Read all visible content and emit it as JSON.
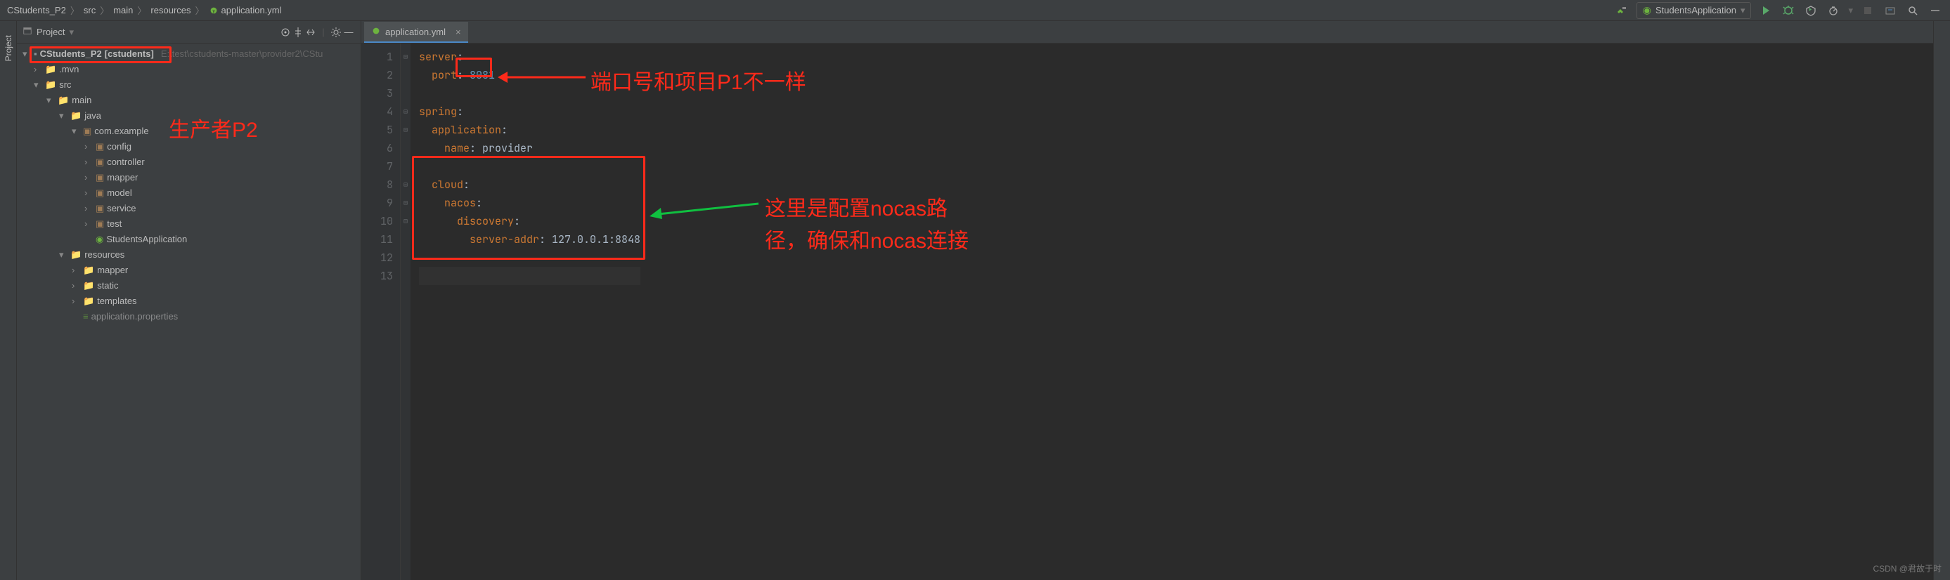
{
  "breadcrumb": {
    "items": [
      "CStudents_P2",
      "src",
      "main",
      "resources",
      "application.yml"
    ]
  },
  "run_config": {
    "name": "StudentsApplication"
  },
  "project_panel": {
    "title": "Project",
    "side_tab": "Project",
    "root": {
      "name": "CStudents_P2",
      "module": "[cstudents]",
      "path": "E:\\test\\cstudents-master\\provider2\\CStu"
    },
    "nodes": {
      "mvn": ".mvn",
      "src": "src",
      "main": "main",
      "java": "java",
      "pkg": "com.example",
      "config": "config",
      "controller": "controller",
      "mapper": "mapper",
      "model": "model",
      "service": "service",
      "test": "test",
      "students_app": "StudentsApplication",
      "resources": "resources",
      "mapper2": "mapper",
      "static": "static",
      "templates": "templates",
      "app_props": "application.properties"
    }
  },
  "editor": {
    "tab": {
      "file": "application.yml"
    },
    "lines": {
      "1": {
        "k1": "server",
        "c": ":"
      },
      "2": {
        "k1": "port",
        "c": ": ",
        "v": "8081"
      },
      "3": {
        "blank": ""
      },
      "4": {
        "k1": "spring",
        "c": ":"
      },
      "5": {
        "k1": "application",
        "c": ":"
      },
      "6": {
        "k1": "name",
        "c": ": ",
        "v": "provider"
      },
      "7": {
        "blank": ""
      },
      "8": {
        "k1": "cloud",
        "c": ":"
      },
      "9": {
        "k1": "nacos",
        "c": ":"
      },
      "10": {
        "k1": "discovery",
        "c": ":"
      },
      "11": {
        "k1": "server-addr",
        "c": ": ",
        "v": "127.0.0.1:8848"
      },
      "12": {
        "blank": ""
      },
      "13": {
        "blank": ""
      }
    },
    "line_numbers": [
      "1",
      "2",
      "3",
      "4",
      "5",
      "6",
      "7",
      "8",
      "9",
      "10",
      "11",
      "12",
      "13"
    ]
  },
  "annotations": {
    "producer": "生产者P2",
    "port_note": "端口号和项目P1不一样",
    "nacos_note_l1": "这里是配置nocas路",
    "nacos_note_l2": "径，确保和nocas连接"
  },
  "watermark": "CSDN @君故于时"
}
